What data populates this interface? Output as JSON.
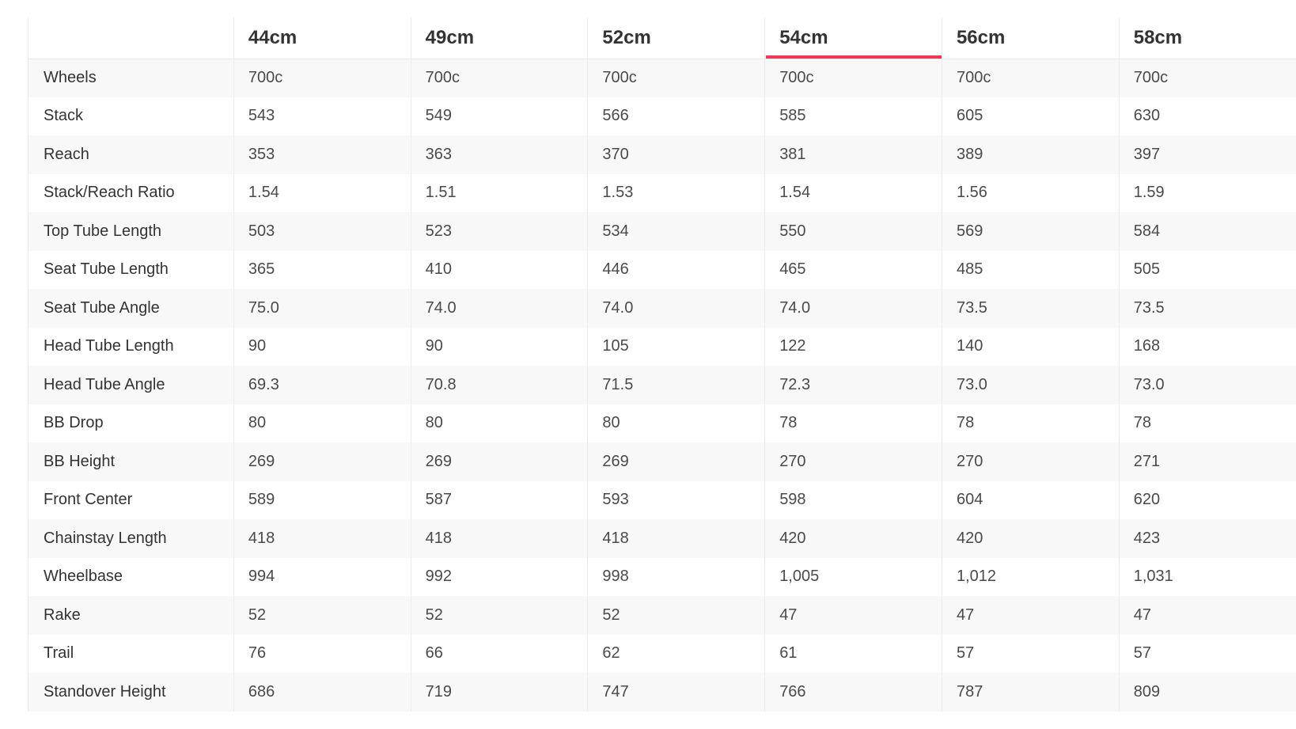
{
  "table": {
    "sizes": [
      "44cm",
      "49cm",
      "52cm",
      "54cm",
      "56cm",
      "58cm"
    ],
    "active_size": "54cm",
    "accent_color": "#ee3a57",
    "rows": [
      {
        "label": "Wheels",
        "values": [
          "700c",
          "700c",
          "700c",
          "700c",
          "700c",
          "700c"
        ]
      },
      {
        "label": "Stack",
        "values": [
          "543",
          "549",
          "566",
          "585",
          "605",
          "630"
        ]
      },
      {
        "label": "Reach",
        "values": [
          "353",
          "363",
          "370",
          "381",
          "389",
          "397"
        ]
      },
      {
        "label": "Stack/Reach Ratio",
        "values": [
          "1.54",
          "1.51",
          "1.53",
          "1.54",
          "1.56",
          "1.59"
        ]
      },
      {
        "label": "Top Tube Length",
        "values": [
          "503",
          "523",
          "534",
          "550",
          "569",
          "584"
        ]
      },
      {
        "label": "Seat Tube Length",
        "values": [
          "365",
          "410",
          "446",
          "465",
          "485",
          "505"
        ]
      },
      {
        "label": "Seat Tube Angle",
        "values": [
          "75.0",
          "74.0",
          "74.0",
          "74.0",
          "73.5",
          "73.5"
        ]
      },
      {
        "label": "Head Tube Length",
        "values": [
          "90",
          "90",
          "105",
          "122",
          "140",
          "168"
        ]
      },
      {
        "label": "Head Tube Angle",
        "values": [
          "69.3",
          "70.8",
          "71.5",
          "72.3",
          "73.0",
          "73.0"
        ]
      },
      {
        "label": "BB Drop",
        "values": [
          "80",
          "80",
          "80",
          "78",
          "78",
          "78"
        ]
      },
      {
        "label": "BB Height",
        "values": [
          "269",
          "269",
          "269",
          "270",
          "270",
          "271"
        ]
      },
      {
        "label": "Front Center",
        "values": [
          "589",
          "587",
          "593",
          "598",
          "604",
          "620"
        ]
      },
      {
        "label": "Chainstay Length",
        "values": [
          "418",
          "418",
          "418",
          "420",
          "420",
          "423"
        ]
      },
      {
        "label": "Wheelbase",
        "values": [
          "994",
          "992",
          "998",
          "1,005",
          "1,012",
          "1,031"
        ]
      },
      {
        "label": "Rake",
        "values": [
          "52",
          "52",
          "52",
          "47",
          "47",
          "47"
        ]
      },
      {
        "label": "Trail",
        "values": [
          "76",
          "66",
          "62",
          "61",
          "57",
          "57"
        ]
      },
      {
        "label": "Standover Height",
        "values": [
          "686",
          "719",
          "747",
          "766",
          "787",
          "809"
        ]
      }
    ]
  }
}
